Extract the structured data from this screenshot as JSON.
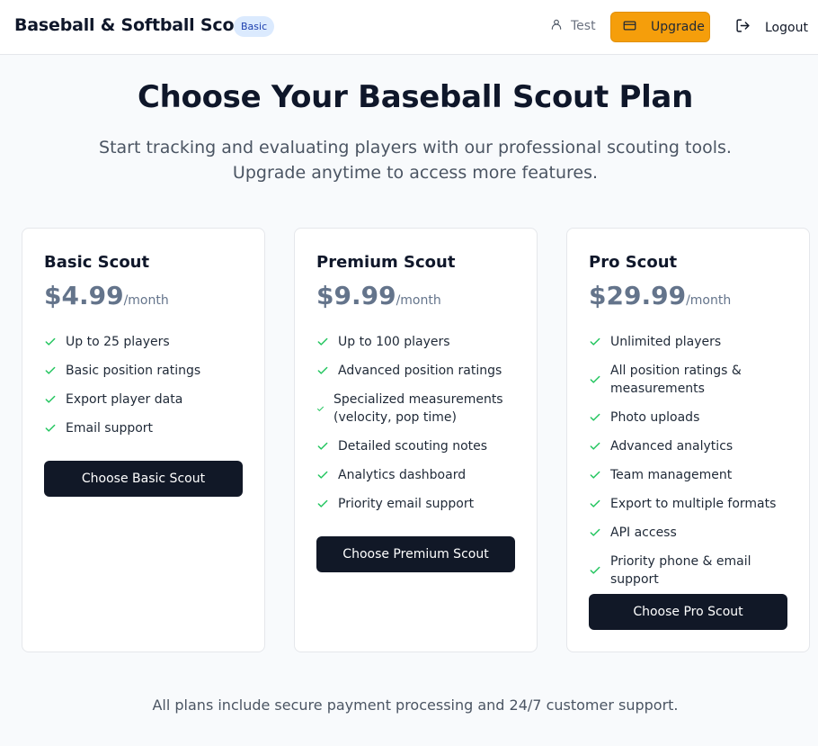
{
  "header": {
    "brand": "Baseball & Softball Scout",
    "plan_badge": "Basic",
    "user_name": "Test",
    "upgrade_label": "Upgrade",
    "logout_label": "Logout"
  },
  "hero": {
    "title": "Choose Your Baseball Scout Plan",
    "subtitle_line1": "Start tracking and evaluating players with our professional scouting tools.",
    "subtitle_line2": "Upgrade anytime to access more features."
  },
  "plans": [
    {
      "name": "Basic Scout",
      "price": "$4.99",
      "period": "/month",
      "features": [
        "Up to 25 players",
        "Basic position ratings",
        "Export player data",
        "Email support"
      ],
      "button": "Choose Basic Scout"
    },
    {
      "name": "Premium Scout",
      "price": "$9.99",
      "period": "/month",
      "features": [
        "Up to 100 players",
        "Advanced position ratings",
        "Specialized measurements (velocity, pop time)",
        "Detailed scouting notes",
        "Analytics dashboard",
        "Priority email support"
      ],
      "button": "Choose Premium Scout"
    },
    {
      "name": "Pro Scout",
      "price": "$29.99",
      "period": "/month",
      "features": [
        "Unlimited players",
        "All position ratings & measurements",
        "Photo uploads",
        "Advanced analytics",
        "Team management",
        "Export to multiple formats",
        "API access",
        "Priority phone & email support"
      ],
      "button": "Choose Pro Scout"
    }
  ],
  "footer_note": "All plans include secure payment processing and 24/7 customer support.",
  "colors": {
    "accent": "#f59e0b",
    "check": "#22c55e",
    "button": "#111827",
    "price": "#64748b",
    "badge_bg": "#dbeafe"
  },
  "icons": {
    "user": "user-icon",
    "upgrade": "credit-card-icon",
    "logout": "logout-icon",
    "feature": "check-icon"
  }
}
